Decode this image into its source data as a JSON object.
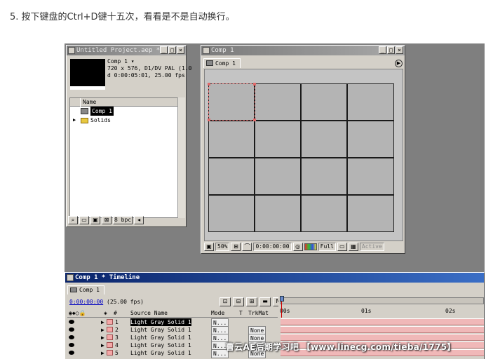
{
  "step": {
    "text": "5. 按下键盘的Ctrl+D键十五次，看看是不是自动换行。"
  },
  "project": {
    "title": "Untitled Project.aep *",
    "comp_name": "Comp 1 ▾",
    "comp_info_size": "720 x 576, D1/DV PAL (1.0",
    "comp_info_duration": "d 0:00:05:01, 25.00 fps",
    "col_name": "Name",
    "items": [
      {
        "label": "Comp 1",
        "selected": true,
        "type": "comp"
      },
      {
        "label": "Solids",
        "selected": false,
        "type": "folder"
      }
    ],
    "bpc": "8 bpc"
  },
  "comp": {
    "title": "Comp 1",
    "tab": "Comp 1",
    "zoom": "50%",
    "timecode": "0:00:00:00",
    "resolution": "Full",
    "camera": "Active",
    "grid_rows": 4,
    "grid_cols": 4
  },
  "timeline": {
    "title": "Comp 1 * Timeline",
    "tab": "Comp 1",
    "timecode": "0:00:00:00",
    "fps": "(25.00 fps)",
    "col_num": "#",
    "col_source": "Source Name",
    "col_mode": "Mode",
    "col_t": "T",
    "col_trkmat": "TrkMat",
    "ruler_ticks": [
      "00s",
      "01s",
      "02s"
    ],
    "layers": [
      {
        "num": "1",
        "name": "Light Gray Solid 1",
        "mode": "N...",
        "trkmat": "",
        "selected": true
      },
      {
        "num": "2",
        "name": "Light Gray Solid 1",
        "mode": "N...",
        "trkmat": "None",
        "selected": true
      },
      {
        "num": "3",
        "name": "Light Gray Solid 1",
        "mode": "N...",
        "trkmat": "None",
        "selected": false
      },
      {
        "num": "4",
        "name": "Light Gray Solid 1",
        "mode": "N...",
        "trkmat": "None",
        "selected": false
      },
      {
        "num": "5",
        "name": "Light Gray Solid 1",
        "mode": "N...",
        "trkmat": "None",
        "selected": false
      }
    ]
  },
  "watermark": {
    "text": "曹云AE后期学习吧 【www.linecg.com/tieba/1775】"
  },
  "colors": {
    "workspace": "#7f7f7f",
    "panel": "#d4d0c8",
    "timeline_title": "#0a246a",
    "layer_label": "#f4a8a8",
    "timecode": "#0000c0"
  }
}
